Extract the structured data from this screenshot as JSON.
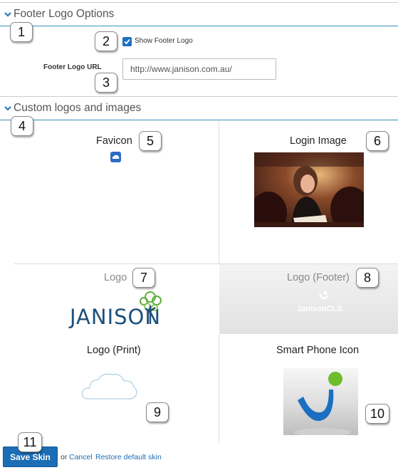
{
  "sections": {
    "footer_logo_options": "Footer Logo Options",
    "custom_logos": "Custom logos and images"
  },
  "footer": {
    "show_logo_label": "Show Footer Logo",
    "show_logo_checked": true,
    "url_label": "Footer Logo URL",
    "url_value": "http://www.janison.com.au/"
  },
  "images": {
    "favicon": "Favicon",
    "login_image": "Login Image",
    "logo": "Logo",
    "logo_footer": "Logo (Footer)",
    "logo_print": "Logo (Print)",
    "smart_phone_icon": "Smart Phone Icon",
    "logo_wordmark": "JANISON",
    "footer_wordmark": "JanisonCLS"
  },
  "actions": {
    "save": "Save Skin",
    "or": "or",
    "cancel": "Cancel",
    "restore": "Restore default skin"
  },
  "callouts": [
    "1",
    "2",
    "3",
    "4",
    "5",
    "6",
    "7",
    "8",
    "9",
    "10",
    "11"
  ],
  "colors": {
    "accent": "#1b6db5",
    "divider": "#3a8fbf",
    "logo_blue": "#1d4f7a",
    "logo_green": "#5fae3a"
  }
}
